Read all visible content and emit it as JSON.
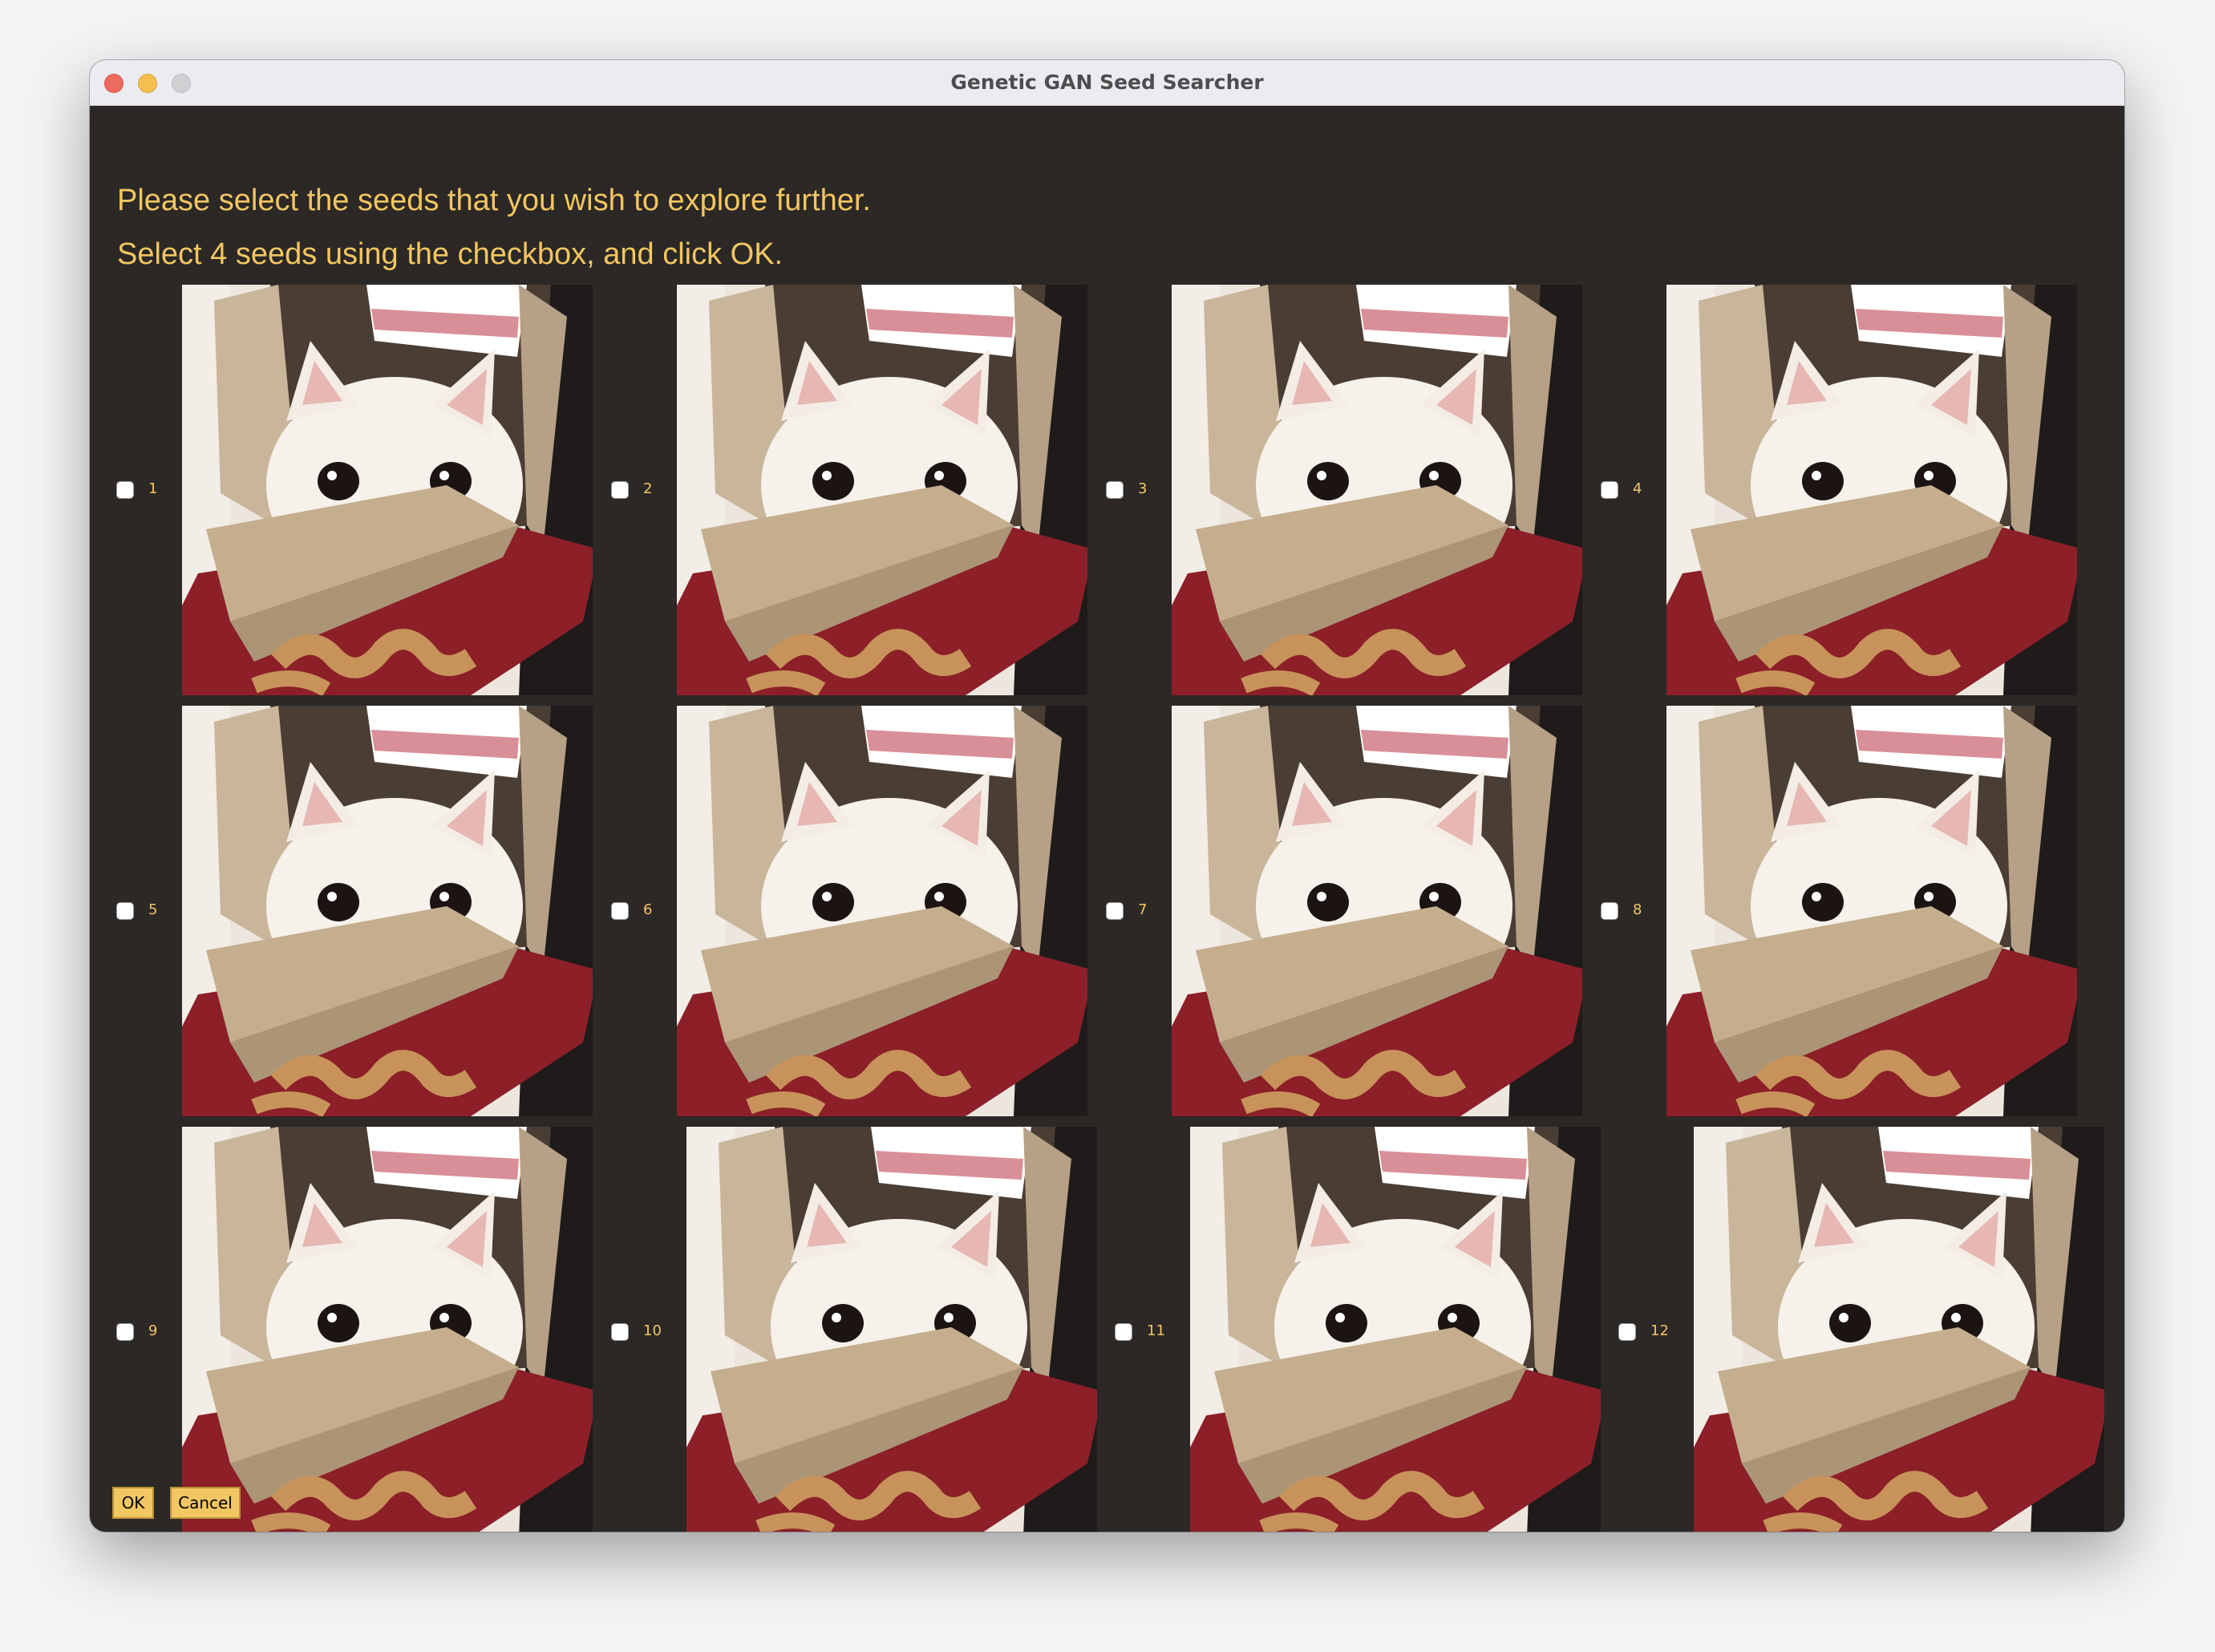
{
  "window": {
    "title": "Genetic GAN Seed Searcher"
  },
  "instructions": {
    "line1": "Please select the seeds that you wish to explore further.",
    "line2": "Select 4 seeds using the checkbox, and click OK."
  },
  "seeds": [
    {
      "label": "1",
      "checked": false
    },
    {
      "label": "2",
      "checked": false
    },
    {
      "label": "3",
      "checked": false
    },
    {
      "label": "4",
      "checked": false
    },
    {
      "label": "5",
      "checked": false
    },
    {
      "label": "6",
      "checked": false
    },
    {
      "label": "7",
      "checked": false
    },
    {
      "label": "8",
      "checked": false
    },
    {
      "label": "9",
      "checked": false
    },
    {
      "label": "10",
      "checked": false
    },
    {
      "label": "11",
      "checked": false
    },
    {
      "label": "12",
      "checked": false
    }
  ],
  "buttons": {
    "ok": "OK",
    "cancel": "Cancel"
  },
  "colors": {
    "background": "#2b2826",
    "text_accent": "#f2c661",
    "button_fill": "#f2c661"
  }
}
